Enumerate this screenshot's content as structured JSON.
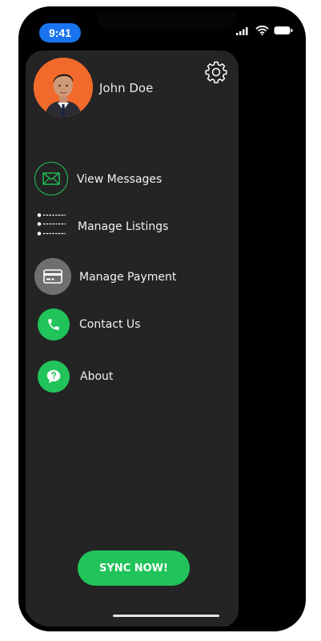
{
  "statusbar": {
    "time": "9:41",
    "signal_icon": "cellular-signal-icon",
    "wifi_icon": "wifi-icon",
    "battery_icon": "battery-icon"
  },
  "drawer": {
    "user": {
      "name": "John Doe",
      "avatar_icon": "user-avatar-photo"
    },
    "settings_icon": "gear-icon",
    "menu": [
      {
        "label": "View Messages",
        "icon": "envelope-icon"
      },
      {
        "label": "Manage Listings",
        "icon": "list-icon"
      },
      {
        "label": "Manage Payment",
        "icon": "credit-card-icon"
      },
      {
        "label": "Contact Us",
        "icon": "phone-icon"
      },
      {
        "label": "About",
        "icon": "question-chat-icon"
      }
    ],
    "sync_button": "SYNC NOW!"
  },
  "colors": {
    "accent_green": "#21c45a",
    "drawer_bg": "#242424",
    "time_pill": "#1a74ef",
    "avatar_bg": "#f26a2b",
    "payment_icon_bg": "#6f6f6f"
  }
}
